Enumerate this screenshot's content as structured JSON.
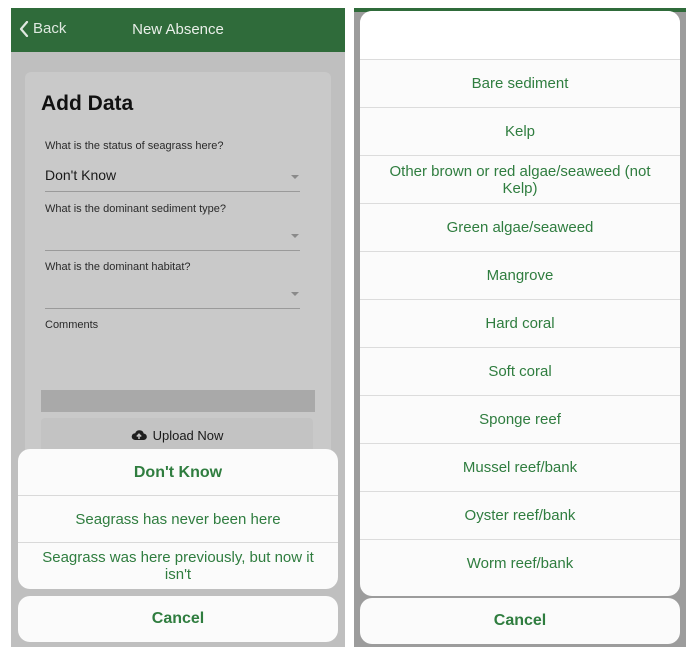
{
  "left": {
    "nav": {
      "back_label": "Back",
      "title": "New Absence"
    },
    "form": {
      "title": "Add Data",
      "status_question": "What is the status of seagrass here?",
      "status_value": "Don't Know",
      "sediment_question": "What is the dominant sediment type?",
      "habitat_question": "What is the dominant habitat?",
      "comments_label": "Comments",
      "upload_label": "Upload Now"
    },
    "sheet": {
      "options": [
        "Don't Know",
        "Seagrass has never been here",
        "Seagrass was here previously, but now it isn't"
      ],
      "cancel_label": "Cancel"
    }
  },
  "right": {
    "options": [
      "Bare sediment",
      "Kelp",
      "Other brown or red algae/seaweed (not Kelp)",
      "Green algae/seaweed",
      "Mangrove",
      "Hard coral",
      "Soft coral",
      "Sponge reef",
      "Mussel reef/bank",
      "Oyster reef/bank",
      "Worm reef/bank"
    ],
    "cancel_label": "Cancel"
  },
  "colors": {
    "nav_green": "#2f6b3a",
    "accent_green": "#2f7d3f"
  }
}
